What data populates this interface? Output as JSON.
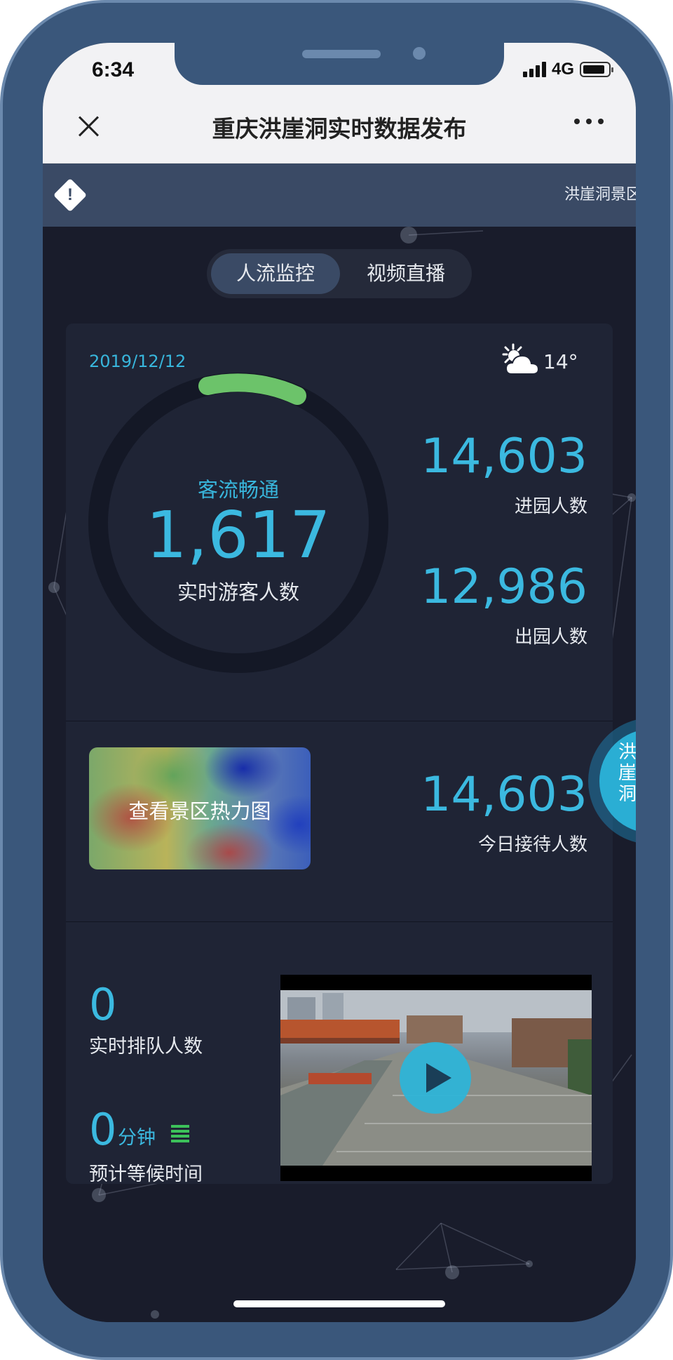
{
  "status_bar": {
    "time": "6:34",
    "network": "4G"
  },
  "title_bar": {
    "title": "重庆洪崖洞实时数据发布"
  },
  "banner": {
    "marquee_text": "洪崖洞景区"
  },
  "tabs": [
    {
      "label": "人流监控",
      "active": true
    },
    {
      "label": "视频直播",
      "active": false
    }
  ],
  "overview": {
    "date": "2019/12/12",
    "weather_icon": "partly-cloudy-icon",
    "temperature": "14°",
    "flow_status": "客流畅通",
    "realtime_visitors": "1,617",
    "realtime_visitors_label": "实时游客人数",
    "entered": "14,603",
    "entered_label": "进园人数",
    "exited": "12,986",
    "exited_label": "出园人数"
  },
  "heatmap": {
    "label": "查看景区热力图"
  },
  "today": {
    "value": "14,603",
    "label": "今日接待人数"
  },
  "queue": {
    "count": "0",
    "count_label": "实时排队人数",
    "wait_value": "0",
    "wait_unit": "分钟",
    "wait_label": "预计等候时间"
  },
  "float_button": {
    "label": "洪崖洞"
  },
  "colors": {
    "accent": "#3bb9e0",
    "ring_progress": "#6cc36a",
    "background": "#191c2b"
  }
}
